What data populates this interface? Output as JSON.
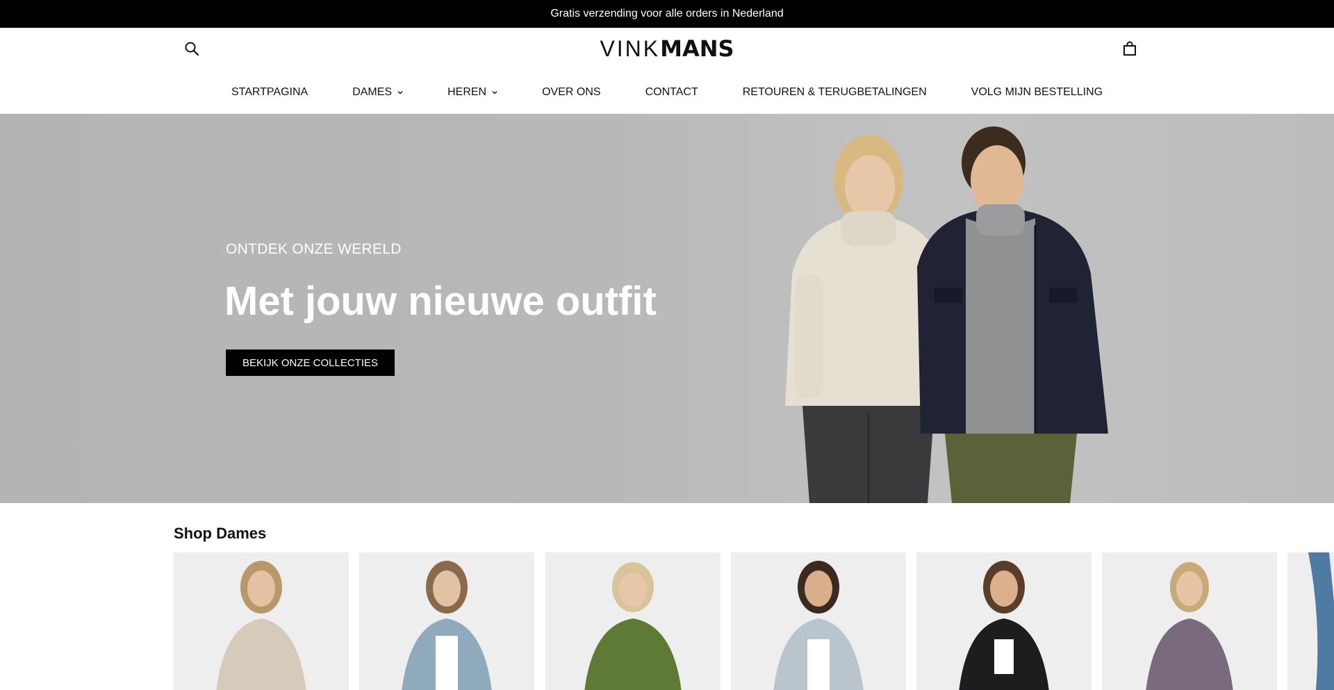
{
  "announcement": "Gratis verzending voor alle orders in Nederland",
  "logo": {
    "light": "VINK",
    "bold": "MANS"
  },
  "icons": {
    "search": "search-icon",
    "cart": "shopping-bag-icon",
    "chevron": "chevron-down-icon"
  },
  "nav": {
    "items": [
      {
        "label": "STARTPAGINA",
        "has_dropdown": false
      },
      {
        "label": "DAMES",
        "has_dropdown": true
      },
      {
        "label": "HEREN",
        "has_dropdown": true
      },
      {
        "label": "OVER ONS",
        "has_dropdown": false
      },
      {
        "label": "CONTACT",
        "has_dropdown": false
      },
      {
        "label": "RETOUREN & TERUGBETALINGEN",
        "has_dropdown": false
      },
      {
        "label": "VOLG MIJN BESTELLING",
        "has_dropdown": false
      }
    ]
  },
  "hero": {
    "eyebrow": "ONTDEK ONZE WERELD",
    "title": "Met jouw nieuwe outfit",
    "cta": "BEKIJK ONZE COLLECTIES"
  },
  "shop_dames": {
    "title": "Shop Dames",
    "products": [
      {
        "garment_color": "#d6cbbb"
      },
      {
        "garment_color": "#8fa9bd"
      },
      {
        "garment_color": "#5f7a34"
      },
      {
        "garment_color": "#b9c4cd"
      },
      {
        "garment_color": "#1d1d1f"
      },
      {
        "garment_color": "#7a6a7e"
      },
      {
        "garment_color": "#4f7aa3"
      }
    ]
  },
  "colors": {
    "announce_bg": "#000000",
    "cta_bg": "#000000",
    "hero_bg": "#b8b8b8"
  }
}
